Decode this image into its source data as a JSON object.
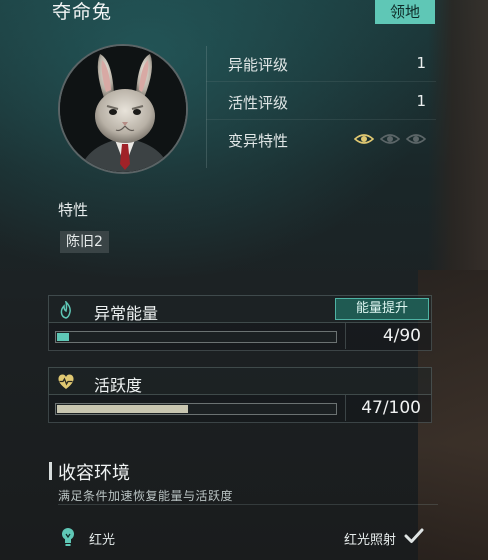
{
  "header": {
    "title": "夺命兔",
    "territory_tag": "领地"
  },
  "stats": [
    {
      "label": "异能评级",
      "value": "1"
    },
    {
      "label": "活性评级",
      "value": "1"
    },
    {
      "label": "变异特性",
      "eyes_active": 1,
      "eyes_total": 3
    }
  ],
  "traits": {
    "heading": "特性",
    "items": [
      "陈旧2"
    ]
  },
  "abnormal_energy": {
    "label": "异常能量",
    "boost_button": "能量提升",
    "value_text": "4/90",
    "current": 4,
    "max": 90,
    "fill_color": "#5fc7b6",
    "icon": "flame-icon"
  },
  "activity": {
    "label": "活跃度",
    "value_text": "47/100",
    "current": 47,
    "max": 100,
    "fill_color": "#c8c6b0",
    "icon": "heartbeat-icon"
  },
  "containment": {
    "title": "收容环境",
    "description": "满足条件加速恢复能量与活跃度",
    "condition_name": "红光",
    "requirement": "红光照射",
    "satisfied": true
  },
  "colors": {
    "accent": "#5fc7b6",
    "icon_gold": "#e0c872"
  }
}
